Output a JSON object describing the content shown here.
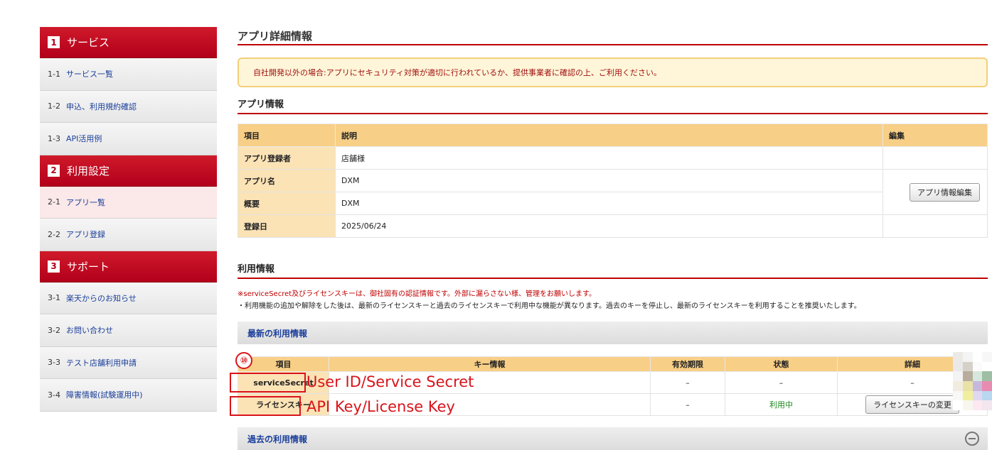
{
  "sidebar": {
    "sections": [
      {
        "num": "1",
        "title": "サービス",
        "items": [
          {
            "num": "1-1",
            "label": "サービス一覧"
          },
          {
            "num": "1-2",
            "label": "申込、利用規約確認"
          },
          {
            "num": "1-3",
            "label": "API活用例"
          }
        ]
      },
      {
        "num": "2",
        "title": "利用設定",
        "items": [
          {
            "num": "2-1",
            "label": "アプリ一覧"
          },
          {
            "num": "2-2",
            "label": "アプリ登録"
          }
        ]
      },
      {
        "num": "3",
        "title": "サポート",
        "items": [
          {
            "num": "3-1",
            "label": "楽天からのお知らせ"
          },
          {
            "num": "3-2",
            "label": "お問い合わせ"
          },
          {
            "num": "3-3",
            "label": "テスト店舗利用申請"
          },
          {
            "num": "3-4",
            "label": "障害情報(試験運用中)"
          }
        ]
      }
    ]
  },
  "page": {
    "title": "アプリ詳細情報",
    "notice": "自社開発以外の場合:アプリにセキュリティ対策が適切に行われているか、提供事業者に確認の上、ご利用ください。"
  },
  "app_info": {
    "heading": "アプリ情報",
    "headers": {
      "item": "項目",
      "desc": "説明",
      "edit": "編集"
    },
    "rows": [
      {
        "label": "アプリ登録者",
        "value": "店舗様"
      },
      {
        "label": "アプリ名",
        "value": "DXM"
      },
      {
        "label": "概要",
        "value": "DXM"
      },
      {
        "label": "登録日",
        "value": "2025/06/24"
      }
    ],
    "edit_button": "アプリ情報編集"
  },
  "usage": {
    "heading": "利用情報",
    "warning": "※serviceSecret及びライセンスキーは、御社固有の認証情報です。外部に漏らさない様、管理をお願いします。",
    "note": "・利用機能の追加や解除をした後は、最新のライセンスキーと過去のライセンスキーで利用中な機能が異なります。過去のキーを停止し、最新のライセンスキーを利用することを推奨いたします。",
    "latest_title": "最新の利用情報",
    "past_title": "過去の利用情報",
    "headers": {
      "item": "項目",
      "key": "キー情報",
      "expiry": "有効期限",
      "status": "状態",
      "detail": "詳細"
    },
    "rows": [
      {
        "item": "serviceSecret",
        "key": "",
        "expiry": "–",
        "status": "–",
        "detail": "–"
      },
      {
        "item": "ライセンスキー",
        "key": "",
        "expiry": "–",
        "status": "利用中",
        "detail_button": "ライセンスキーの変更"
      }
    ]
  },
  "annotations": {
    "number": "⑩",
    "label1": "User ID/Service Secret",
    "label2": "API Key/License Key"
  },
  "colors": {
    "accent": "#bf0000",
    "table_header": "#f8cf86",
    "annotation": "#d8141b"
  }
}
